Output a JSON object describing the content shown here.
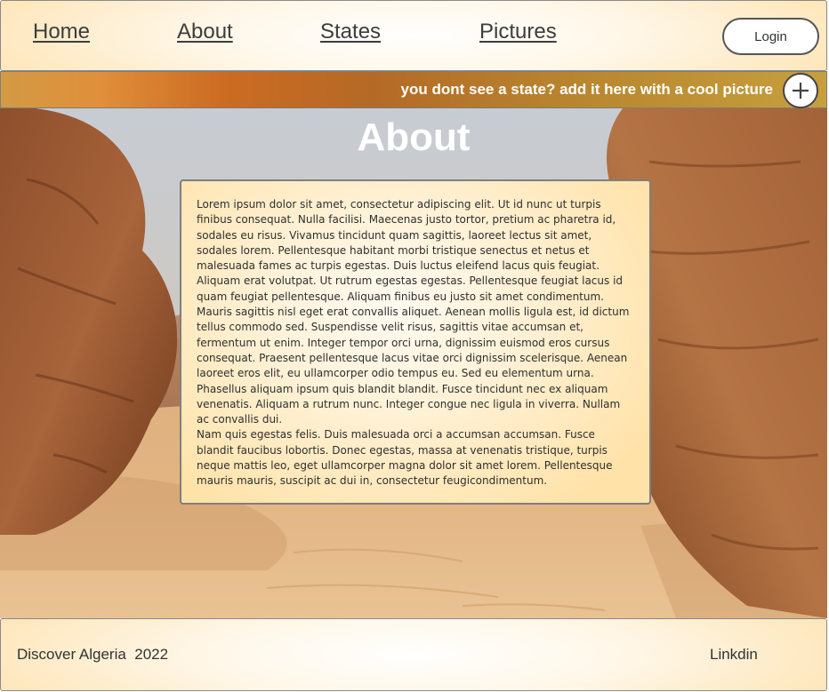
{
  "nav": {
    "home": "Home",
    "about": "About",
    "states": "States",
    "pictures": "Pictures",
    "login": "Login"
  },
  "banner": {
    "text": "you dont see a state? add it here with a cool picture",
    "add_icon": "plus-icon"
  },
  "hero": {
    "title": "About",
    "paragraphs": [
      "Lorem ipsum dolor sit amet, consectetur adipiscing elit. Ut id nunc ut turpis finibus consequat. Nulla facilisi. Maecenas justo tortor, pretium ac pharetra id, sodales eu risus. Vivamus tincidunt quam sagittis, laoreet lectus sit amet, sodales lorem. Pellentesque habitant morbi tristique senectus et netus et malesuada fames ac turpis egestas. Duis luctus eleifend lacus quis feugiat. Aliquam erat volutpat. Ut rutrum egestas egestas. Pellentesque feugiat lacus id quam feugiat pellentesque. Aliquam finibus eu justo sit amet condimentum.",
      "Mauris sagittis nisl eget erat convallis aliquet. Aenean mollis ligula est, id dictum tellus commodo sed. Suspendisse velit risus, sagittis vitae accumsan et, fermentum ut enim. Integer tempor orci urna, dignissim euismod eros cursus consequat. Praesent pellentesque lacus vitae orci dignissim scelerisque. Aenean laoreet eros elit, eu ullamcorper odio tempus eu. Sed eu elementum urna. Phasellus aliquam ipsum quis blandit blandit. Fusce tincidunt nec ex aliquam venenatis. Aliquam a rutrum nunc. Integer congue nec ligula in viverra. Nullam ac convallis dui.",
      "Nam quis egestas felis. Duis malesuada orci a accumsan accumsan. Fusce blandit faucibus lobortis. Donec egestas, massa at venenatis tristique, turpis neque mattis leo, eget ullamcorper magna dolor sit amet lorem. Pellentesque mauris mauris, suscipit ac dui in, consectetur feugicondimentum."
    ]
  },
  "footer": {
    "text": "Discover Algeria  2022",
    "link": "Linkdin"
  },
  "colors": {
    "accent_orange": "#cc6b22",
    "sand": "#e2b583",
    "rock": "#9a5a34"
  }
}
